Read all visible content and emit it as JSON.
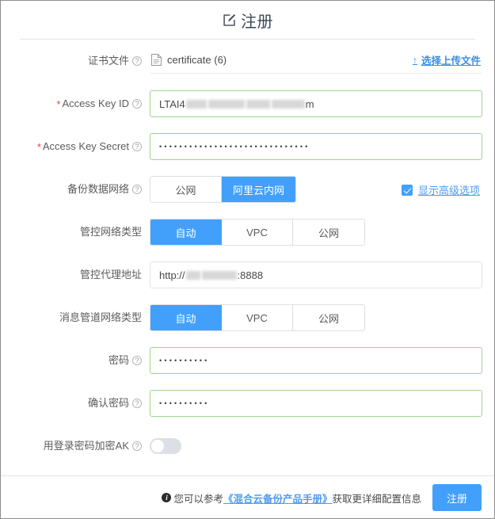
{
  "dialog": {
    "title": "注册",
    "title_icon": "edit-square-icon"
  },
  "form": {
    "certificate": {
      "label": "证书文件",
      "help_icon": "question-circle-icon",
      "file_icon": "file-icon",
      "file_name": "certificate (6)",
      "upload_link": "选择上传文件",
      "upload_icon": "upload-arrow-icon"
    },
    "access_key_id": {
      "label": "Access Key ID",
      "required_mark": "*",
      "help_icon": "question-circle-icon",
      "value_prefix": "LTAI4",
      "value_suffix": "m",
      "redacted": true
    },
    "access_key_secret": {
      "label": "Access Key Secret",
      "required_mark": "*",
      "help_icon": "question-circle-icon",
      "value_masked": "••••••••••••••••••••••••••••••",
      "masked_char_count": 30
    },
    "backup_network": {
      "label": "备份数据网络",
      "help_icon": "question-circle-icon",
      "options": [
        "公网",
        "阿里云内网"
      ],
      "selected": "阿里云内网"
    },
    "advanced_options": {
      "label": "显示高级选项",
      "checked": true
    },
    "control_network_type": {
      "label": "管控网络类型",
      "options": [
        "自动",
        "VPC",
        "公网"
      ],
      "selected": "自动"
    },
    "control_proxy_address": {
      "label": "管控代理地址",
      "value_prefix": "http://",
      "value_suffix": ":8888",
      "redacted": true
    },
    "message_channel_network_type": {
      "label": "消息管道网络类型",
      "options": [
        "自动",
        "VPC",
        "公网"
      ],
      "selected": "自动"
    },
    "password": {
      "label": "密码",
      "help_icon": "question-circle-icon",
      "value_masked": "••••••••••",
      "masked_char_count": 10
    },
    "confirm_password": {
      "label": "确认密码",
      "help_icon": "question-circle-icon",
      "value_masked": "••••••••••",
      "masked_char_count": 10
    },
    "encrypt_ak": {
      "label": "用登录密码加密AK",
      "help_icon": "question-circle-icon",
      "enabled": false
    }
  },
  "footer": {
    "info_icon": "info-icon",
    "note_before": "您可以参考 ",
    "manual_link": "《混合云备份产品手册》",
    "note_after": " 获取更详细配置信息",
    "submit_label": "注册"
  },
  "colors": {
    "accent_blue": "#42a0fb",
    "link_blue": "#4d9bf0",
    "valid_green": "#9cd68a",
    "required_red": "#f04134",
    "border_gray": "#dcdfe6"
  }
}
